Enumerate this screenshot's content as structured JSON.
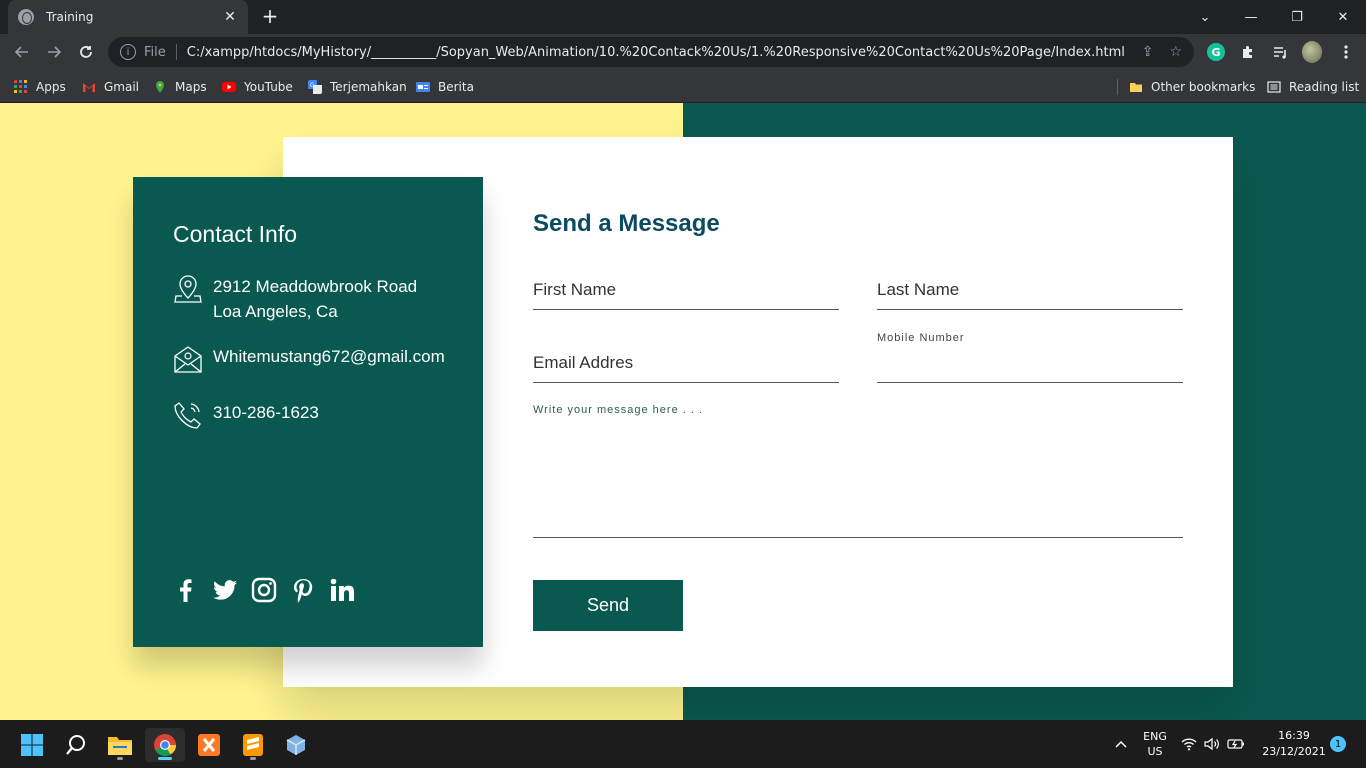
{
  "browser": {
    "tab_title": "Training",
    "tab_close": "✕",
    "new_tab": "+",
    "url_scheme": "File",
    "url": "C:/xampp/htdocs/MyHistory/__________/Sopyan_Web/Animation/10.%20Contack%20Us/1.%20Responsive%20Contact%20Us%20Page/Index.html",
    "window_controls": {
      "dropdown": "⌄",
      "minimize": "—",
      "restore": "❐",
      "close": "✕"
    },
    "bookmarks": [
      {
        "label": "Apps",
        "icon": "apps-grid-icon"
      },
      {
        "label": "Gmail",
        "icon": "gmail-icon"
      },
      {
        "label": "Maps",
        "icon": "maps-icon"
      },
      {
        "label": "YouTube",
        "icon": "youtube-icon"
      },
      {
        "label": "Terjemahkan",
        "icon": "translate-icon"
      },
      {
        "label": "Berita",
        "icon": "news-icon"
      }
    ],
    "other_bookmarks": "Other bookmarks",
    "reading_list": "Reading list"
  },
  "page": {
    "colors": {
      "left_bg": "#fff48f",
      "right_bg": "#0a5950",
      "panel": "#0a5950",
      "button": "#0a5950",
      "title": "#0c4a60"
    },
    "contact_info": {
      "title": "Contact Info",
      "address_line1": "2912 Meaddowbrook Road",
      "address_line2": "Loa Angeles, Ca",
      "email": "Whitemustang672@gmail.com",
      "phone": "310-286-1623",
      "social": [
        "facebook-icon",
        "twitter-icon",
        "instagram-icon",
        "pinterest-icon",
        "linkedin-icon"
      ]
    },
    "form": {
      "title": "Send a Message",
      "first_name": "First Name",
      "last_name": "Last Name",
      "email": "Email Addres",
      "mobile": "Mobile Number",
      "message": "Write your message here . . .",
      "send": "Send"
    }
  },
  "taskbar": {
    "lang_line1": "ENG",
    "lang_line2": "US",
    "time": "16:39",
    "date": "23/12/2021",
    "notifications": "1"
  }
}
